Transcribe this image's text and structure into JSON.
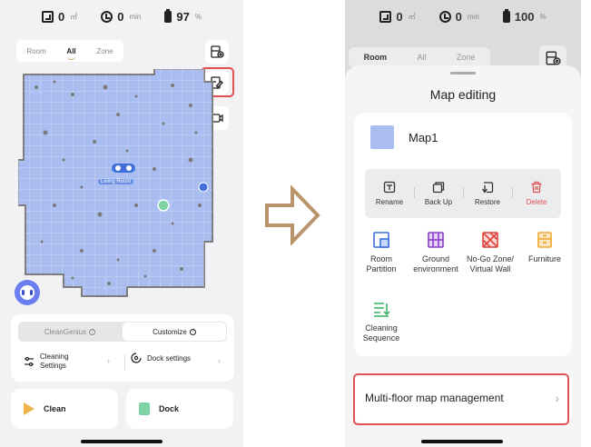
{
  "left_screen": {
    "status": {
      "area_value": "0",
      "area_unit": "㎡",
      "time_value": "0",
      "time_unit": "min",
      "battery_value": "97",
      "battery_unit": "%"
    },
    "mode_tabs": [
      "Room",
      "All",
      "Zone"
    ],
    "active_mode": "All",
    "map_room_label": "Living Room",
    "control_tabs": [
      "CleanGenius",
      "Customize"
    ],
    "active_control": "Customize",
    "settings": {
      "cleaning_line1": "Cleaning",
      "cleaning_line2": "Settings",
      "dock": "Dock settings"
    },
    "actions": {
      "clean": "Clean",
      "dock": "Dock"
    }
  },
  "right_screen": {
    "status": {
      "area_value": "0",
      "area_unit": "㎡",
      "time_value": "0",
      "time_unit": "min",
      "battery_value": "100",
      "battery_unit": "%"
    },
    "mode_tabs": [
      "Room",
      "All",
      "Zone"
    ],
    "active_mode": "Room",
    "sheet_title": "Map editing",
    "map_name": "Map1",
    "map_actions": [
      {
        "label": "Rename",
        "icon": "rename-icon"
      },
      {
        "label": "Back Up",
        "icon": "backup-icon"
      },
      {
        "label": "Restore",
        "icon": "restore-icon"
      },
      {
        "label": "Delete",
        "icon": "trash-icon"
      }
    ],
    "tools": [
      {
        "line1": "Room",
        "line2": "Partition",
        "icon": "room-partition-icon",
        "color": "#3b6fe0"
      },
      {
        "line1": "Ground",
        "line2": "environment",
        "icon": "ground-environment-icon",
        "color": "#8a3fd1"
      },
      {
        "line1": "No-Go Zone/",
        "line2": "Virtual Wall",
        "icon": "no-go-zone-icon",
        "color": "#e0443e"
      },
      {
        "line1": "Furniture",
        "line2": "",
        "icon": "furniture-icon",
        "color": "#f0a52f"
      },
      {
        "line1": "Cleaning",
        "line2": "Sequence",
        "icon": "cleaning-sequence-icon",
        "color": "#3fb56a"
      }
    ],
    "multi_floor_label": "Multi-floor map management"
  },
  "colors": {
    "highlight": "#e05252",
    "map_fill": "#a9bdf0",
    "arrow_stroke": "#b9936a"
  }
}
